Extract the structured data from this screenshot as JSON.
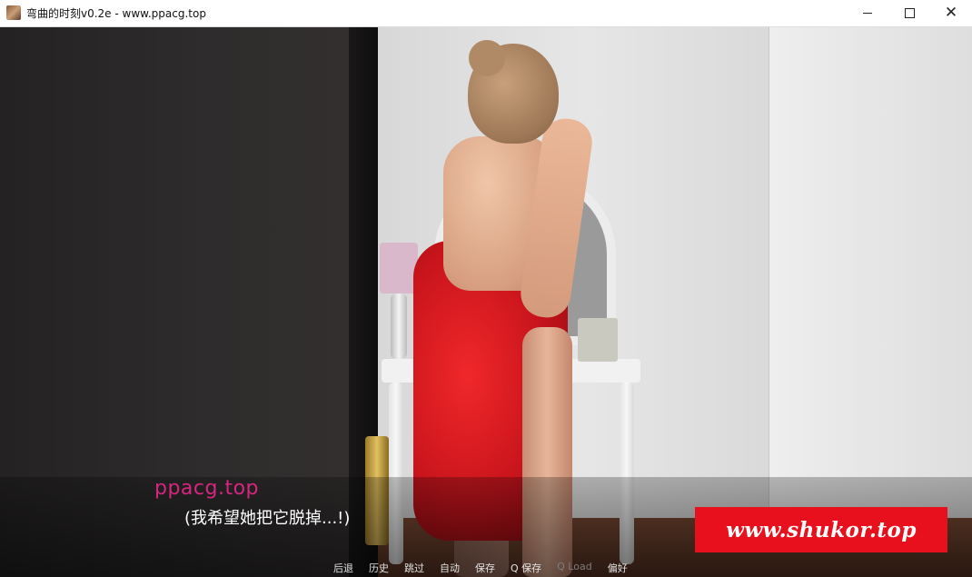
{
  "window": {
    "title": "弯曲的时刻v0.2e - www.ppacg.top",
    "controls": {
      "minimize_icon": "minimize-icon",
      "maximize_icon": "maximize-icon",
      "close_glyph": "✕"
    }
  },
  "dialogue": {
    "speaker": "ppacg.top",
    "text": "(我希望她把它脱掉...!)",
    "speaker_color": "#d6267f"
  },
  "watermark": {
    "text": "www.shukor.top",
    "background": "#e8101c"
  },
  "quick_menu": {
    "items": [
      {
        "label": "后退",
        "enabled": true
      },
      {
        "label": "历史",
        "enabled": true
      },
      {
        "label": "跳过",
        "enabled": true
      },
      {
        "label": "自动",
        "enabled": true
      },
      {
        "label": "保存",
        "enabled": true
      },
      {
        "label": "Q 保存",
        "enabled": true
      },
      {
        "label": "Q Load",
        "enabled": false
      },
      {
        "label": "偏好",
        "enabled": true
      }
    ]
  }
}
